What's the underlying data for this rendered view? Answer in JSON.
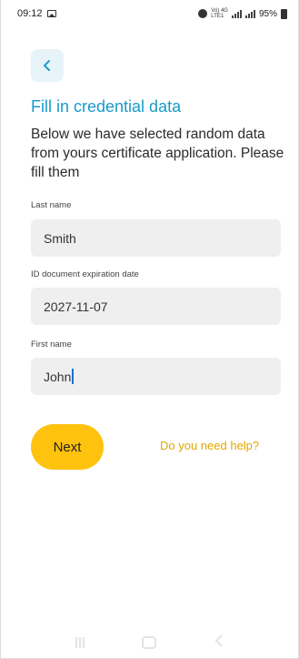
{
  "status_bar": {
    "time": "09:12",
    "network": "Vo) 4G\nLTE1",
    "battery": "95%",
    "icons": [
      "gallery-icon",
      "alarm-icon",
      "signal-icon",
      "battery-icon"
    ]
  },
  "back_button": {
    "icon": "chevron-left-icon"
  },
  "title": "Fill in credential data",
  "description": "Below we have selected random data from yours certificate application. Please fill them",
  "fields": [
    {
      "label": "Last name",
      "value": "Smith"
    },
    {
      "label": "ID document expiration date",
      "value": "2027-11-07"
    },
    {
      "label": "First name",
      "value": "John"
    }
  ],
  "actions": {
    "next_label": "Next",
    "help_label": "Do you need help?"
  },
  "colors": {
    "accent": "#1a9ac9",
    "button": "#ffc20f",
    "help": "#e0a800",
    "field_bg": "#efefef",
    "back_bg": "#e6f4f9"
  }
}
